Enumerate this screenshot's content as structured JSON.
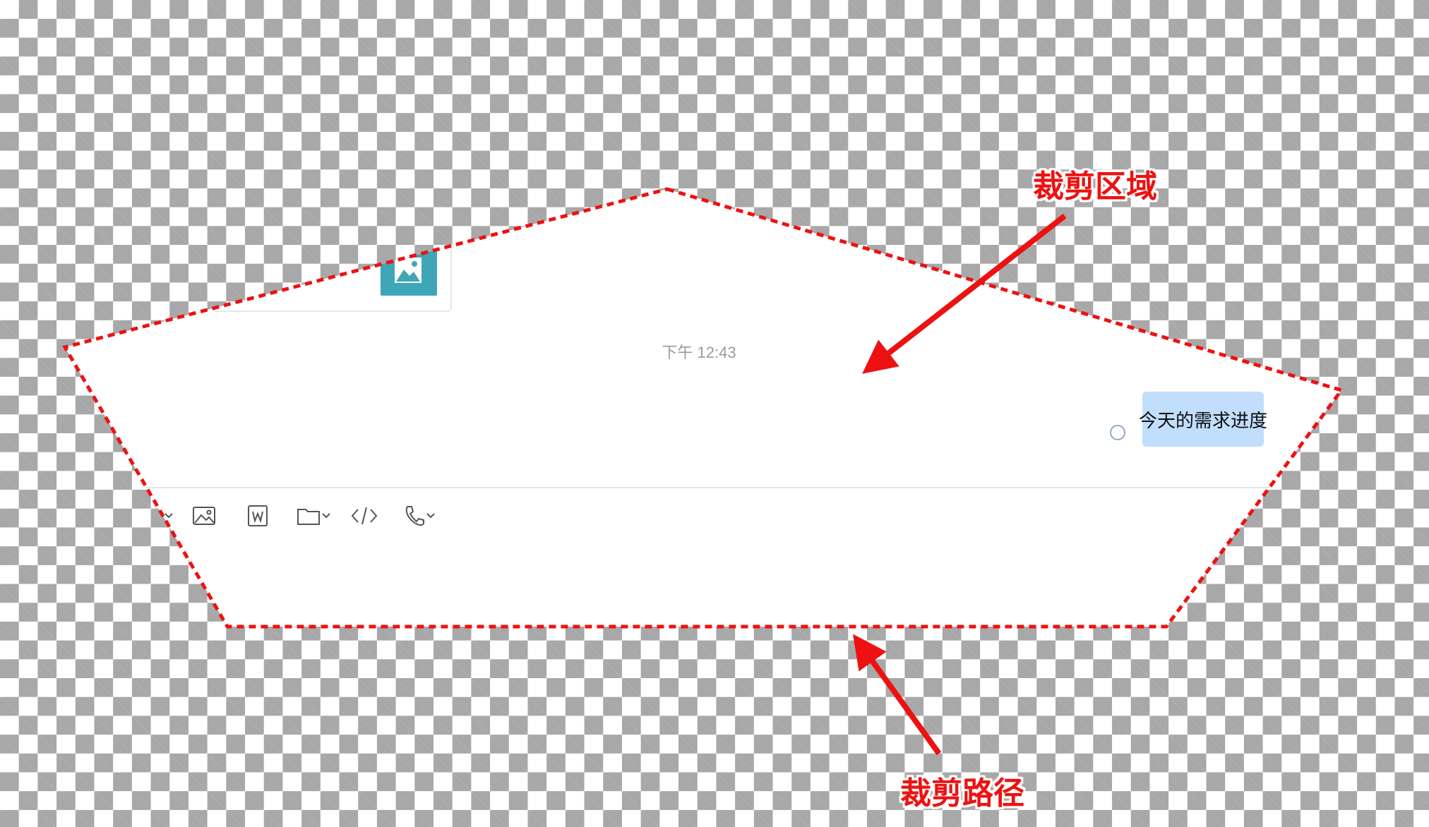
{
  "chat": {
    "timestamp": "下午 12:43",
    "message": "今天的需求进度",
    "toolbar": [
      {
        "icon": "chevron-down-icon"
      },
      {
        "icon": "image-icon"
      },
      {
        "icon": "word-doc-icon"
      },
      {
        "icon": "folder-icon"
      },
      {
        "icon": "code-icon"
      },
      {
        "icon": "phone-icon"
      }
    ]
  },
  "annotations": {
    "clip_area_label": "裁剪区域",
    "clip_path_label": "裁剪路径"
  },
  "colors": {
    "annotation": "#ee1111",
    "bubble": "#c2defd",
    "thumbnail": "#3fa6b8"
  }
}
